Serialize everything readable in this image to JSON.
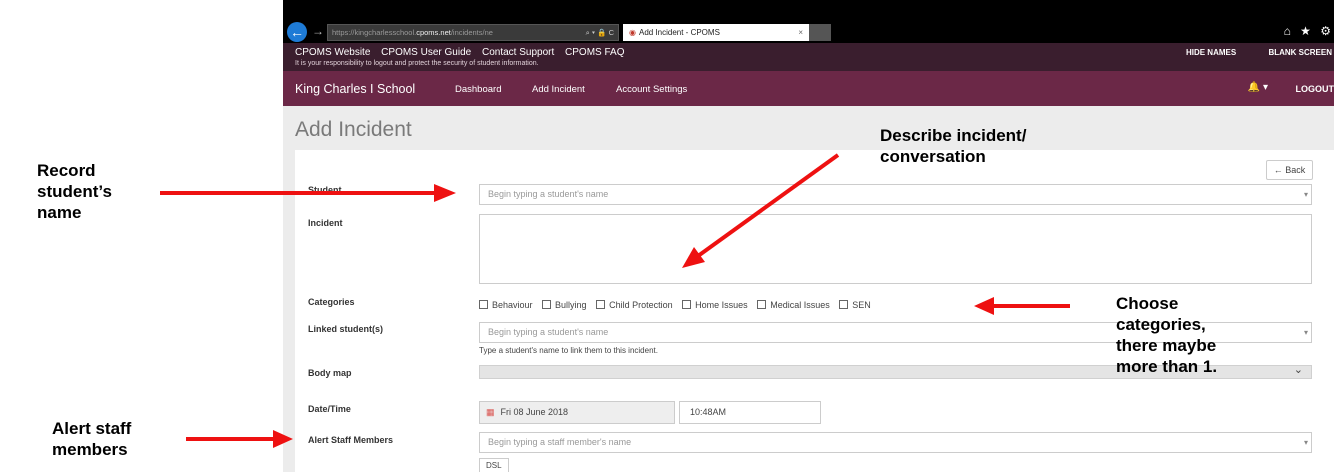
{
  "browser": {
    "url_prefix": "https://",
    "url_host": "kingcharlesschool.",
    "url_domain": "cpoms.net",
    "url_path": "/incidents/ne",
    "addr_controls": "⌕ ▾ 🔒 C",
    "tab_title": "Add Incident - CPOMS",
    "tab_close": "×",
    "right_icons": "⌂ ★ ⚙"
  },
  "topbar": {
    "links": [
      "CPOMS Website",
      "CPOMS User Guide",
      "Contact Support",
      "CPOMS FAQ"
    ],
    "responsibility_note": "It is your responsibility to logout and protect the security of student information.",
    "hide_names": "HIDE NAMES",
    "blank_screen": "BLANK SCREEN"
  },
  "navbar": {
    "school_name": "King Charles I School",
    "items": [
      "Dashboard",
      "Add Incident",
      "Account Settings"
    ],
    "bell": "🔔 ▾",
    "logout": "LOGOUT"
  },
  "page": {
    "title": "Add Incident",
    "back_label": "← Back"
  },
  "form": {
    "student_label": "Student",
    "student_placeholder": "Begin typing a student's name",
    "incident_label": "Incident",
    "categories_label": "Categories",
    "categories": [
      "Behaviour",
      "Bullying",
      "Child Protection",
      "Home Issues",
      "Medical Issues",
      "SEN"
    ],
    "linked_label": "Linked student(s)",
    "linked_placeholder": "Begin typing a student's name",
    "linked_help": "Type a student's name to link them to this incident.",
    "bodymap_label": "Body map",
    "datetime_label": "Date/Time",
    "date_value": "Fri 08 June 2018",
    "time_value": "10:48AM",
    "alert_label": "Alert Staff Members",
    "alert_placeholder": "Begin typing a staff member's name",
    "dsl_tag": "DSL"
  },
  "annotations": {
    "record_student": [
      "Record",
      "student’s",
      "name"
    ],
    "describe_incident": [
      "Describe incident/",
      "conversation"
    ],
    "choose_categories": [
      "Choose",
      "categories,",
      "there maybe",
      "more than 1."
    ],
    "alert_staff": [
      "Alert staff",
      "members"
    ]
  },
  "colors": {
    "topbar": "#3a1e2e",
    "navbar": "#6b2847",
    "arrow": "#ee1111"
  }
}
